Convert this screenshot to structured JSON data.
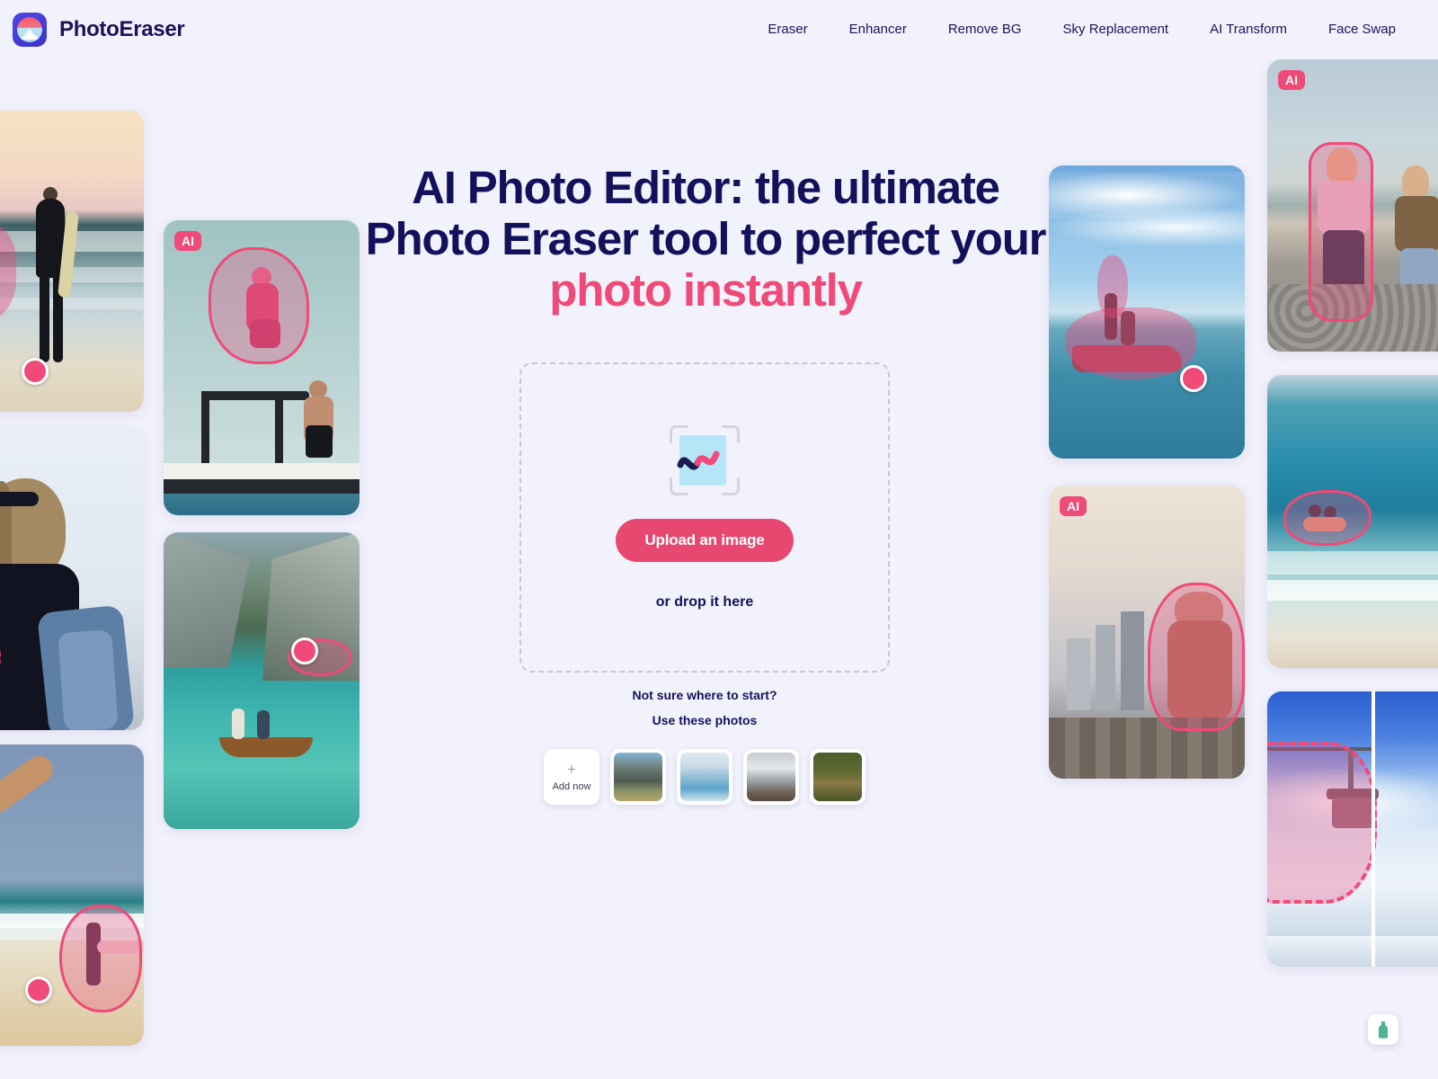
{
  "brand": {
    "name": "PhotoEraser",
    "logo_icon": "mountain-sunset-icon"
  },
  "nav": {
    "items": [
      {
        "label": "Eraser"
      },
      {
        "label": "Enhancer"
      },
      {
        "label": "Remove BG"
      },
      {
        "label": "Sky Replacement"
      },
      {
        "label": "AI Transform"
      },
      {
        "label": "Face Swap"
      }
    ]
  },
  "hero": {
    "line1": "AI Photo Editor: the ultimate",
    "line2": "Photo Eraser tool to perfect your",
    "line3_accent": "photo instantly"
  },
  "dropzone": {
    "icon": "image-scan-icon",
    "upload_label": "Upload an image",
    "drop_label": "or drop it here"
  },
  "starter": {
    "question": "Not sure where to start?",
    "subtitle": "Use these photos",
    "add_now_label": "Add now",
    "add_now_icon": "plus-icon",
    "samples": [
      {
        "name": "mountain-hikers-thumb"
      },
      {
        "name": "glacier-lagoon-thumb"
      },
      {
        "name": "snow-peaks-thumb"
      },
      {
        "name": "forest-path-thumb"
      }
    ]
  },
  "collage": {
    "badge_label": "AI",
    "cards": [
      {
        "name": "surfer-sunset-card",
        "badge": false,
        "cursor": true
      },
      {
        "name": "denim-woman-beforeafter-card",
        "badge": false,
        "cursor": false
      },
      {
        "name": "handstand-beach-card",
        "badge": false,
        "cursor": true
      },
      {
        "name": "boat-jump-card",
        "badge": true,
        "cursor": false
      },
      {
        "name": "lake-rowboat-card",
        "badge": false,
        "cursor": true
      },
      {
        "name": "jetski-ocean-card",
        "badge": false,
        "cursor": true
      },
      {
        "name": "city-overlook-card",
        "badge": true,
        "cursor": false
      },
      {
        "name": "beach-walkers-card",
        "badge": true,
        "cursor": false
      },
      {
        "name": "ocean-wave-swimmers-card",
        "badge": false,
        "cursor": false
      },
      {
        "name": "chairlift-sky-beforeafter-card",
        "badge": false,
        "cursor": false
      }
    ]
  },
  "float_button": {
    "name": "feedback-bottle-button",
    "icon": "bottle-icon",
    "color": "#4bb58b"
  },
  "colors": {
    "background": "#f2f2fd",
    "heading": "#14115c",
    "accent_pink": "#ef4a78",
    "button_pink": "#e8486f",
    "brand_indigo": "#4f46e5"
  }
}
